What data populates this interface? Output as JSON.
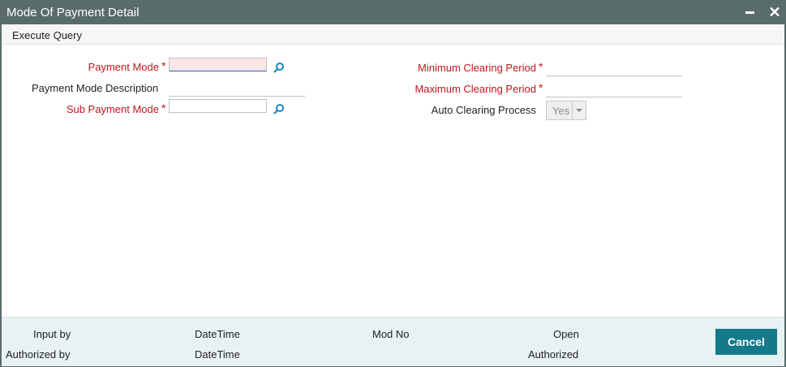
{
  "window": {
    "title": "Mode Of Payment Detail"
  },
  "menu": {
    "execute_query": "Execute Query"
  },
  "left_fields": {
    "payment_mode": {
      "label": "Payment Mode",
      "value": ""
    },
    "payment_mode_description": {
      "label": "Payment Mode Description",
      "value": ""
    },
    "sub_payment_mode": {
      "label": "Sub Payment Mode",
      "value": ""
    }
  },
  "right_fields": {
    "minimum_clearing_period": {
      "label": "Minimum Clearing Period",
      "value": ""
    },
    "maximum_clearing_period": {
      "label": "Maximum Clearing Period",
      "value": ""
    },
    "auto_clearing_process": {
      "label": "Auto Clearing Process",
      "selected": "Yes"
    }
  },
  "required_marker": "*",
  "footer": {
    "input_by": "Input by",
    "datetime_1": "DateTime",
    "mod_no": "Mod No",
    "open": "Open",
    "authorized_by": "Authorized by",
    "datetime_2": "DateTime",
    "authorized": "Authorized",
    "cancel_label": "Cancel"
  },
  "colors": {
    "titlebar": "#5a6b6b",
    "required_label": "#c0141d",
    "cancel_button": "#127a8a",
    "footer_bg": "#e8f2f2",
    "lov_icon": "#1a86c2"
  },
  "icons": {
    "lov": "search-icon",
    "minimize": "minimize-icon",
    "close": "close-icon",
    "dropdown": "chevron-down-icon"
  }
}
